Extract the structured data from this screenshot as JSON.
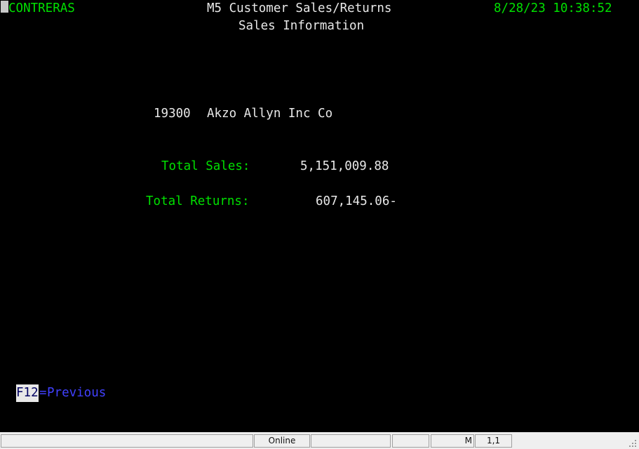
{
  "terminal": {
    "screen_id": "M5-customer-sales-returns",
    "background_color": "#000000",
    "colors": {
      "green": "#00e000",
      "white": "#e8e8e8",
      "blue": "#4040ff",
      "cursor": "#c8c8c8",
      "reverse_text": "#000060",
      "reverse_background": "#e8e8e8"
    },
    "header": {
      "user": "CONTRERAS",
      "title": "M5 Customer Sales/Returns",
      "subtitle": "Sales Information",
      "date": "8/28/23",
      "time": "10:38:52",
      "datetime": "8/28/23 10:38:52"
    },
    "customer": {
      "number": "19300",
      "name": "Akzo Allyn Inc Co",
      "line": "19300  Akzo Allyn Inc Co"
    },
    "fields": [
      {
        "label": "Total Sales:",
        "value": "5,151,009.88"
      },
      {
        "label": "Total Returns:",
        "value": "607,145.06-"
      }
    ],
    "function_keys": [
      {
        "key": "F12",
        "separator": "=",
        "action": "Previous"
      }
    ]
  },
  "statusbar": {
    "blank_left": "",
    "connection": "Online",
    "blank_2": "",
    "blank_3": "",
    "mode": "M",
    "position": "1,1",
    "blank_right": ""
  }
}
